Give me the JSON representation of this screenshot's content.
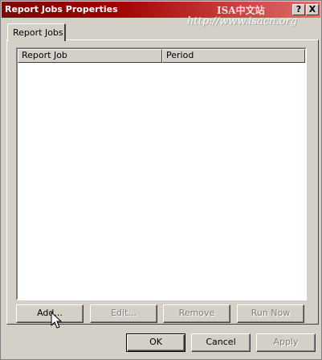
{
  "window": {
    "title": "Report Jobs Properties"
  },
  "watermark": {
    "line1": "ISA中文站",
    "line2": "http://www.isacn.org"
  },
  "title_buttons": {
    "help": "?",
    "close": "X"
  },
  "tabs": [
    {
      "label": "Report Jobs"
    }
  ],
  "list": {
    "columns": [
      {
        "label": "Report Job"
      },
      {
        "label": "Period"
      }
    ],
    "rows": []
  },
  "actions": {
    "add": "Add...",
    "edit": "Edit...",
    "remove": "Remove",
    "run_now": "Run Now"
  },
  "footer": {
    "ok": "OK",
    "cancel": "Cancel",
    "apply": "Apply"
  },
  "colors": {
    "titlebar_start": "#7a0a0a",
    "titlebar_end": "#e07070",
    "face": "#d4d0c8"
  }
}
